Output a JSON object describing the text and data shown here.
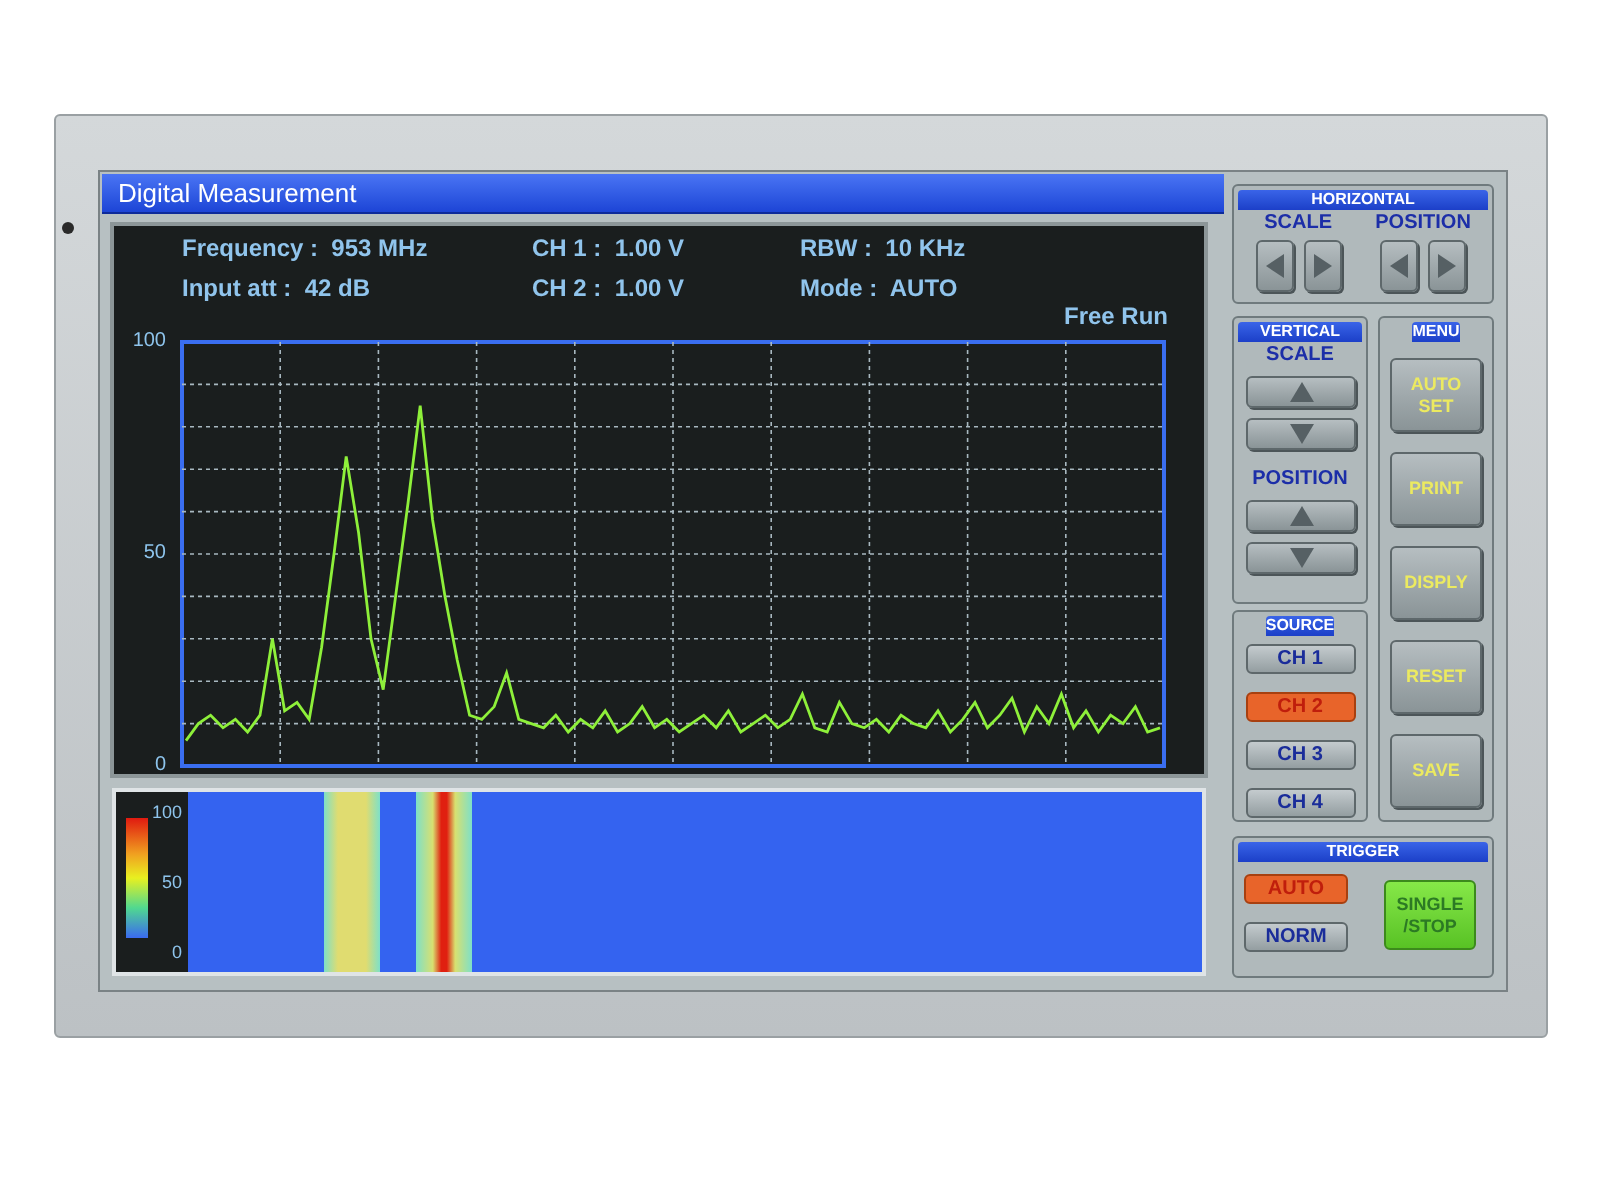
{
  "window": {
    "title": "Digital Measurement"
  },
  "readouts": [
    "Frequency :  953 MHz",
    "CH 1 :  1.00 V",
    "RBW :  10 KHz",
    "Input att :  42 dB",
    "CH 2 :  1.00 V",
    "Mode :  AUTO"
  ],
  "spectrum": {
    "status": "Free Run",
    "chart_data": {
      "type": "line",
      "ylim": [
        0,
        100
      ],
      "yticks": [
        0,
        50,
        100
      ],
      "series": [
        {
          "color": "#8ef03a",
          "values": [
            6,
            10,
            12,
            9,
            11,
            8,
            12,
            30,
            13,
            15,
            11,
            28,
            50,
            73,
            55,
            30,
            18,
            40,
            62,
            85,
            58,
            40,
            25,
            12,
            11,
            14,
            22,
            11,
            10,
            9,
            12,
            8,
            11,
            9,
            13,
            8,
            10,
            14,
            9,
            11,
            8,
            10,
            12,
            9,
            13,
            8,
            10,
            12,
            9,
            11,
            17,
            9,
            8,
            15,
            10,
            9,
            11,
            8,
            12,
            10,
            9,
            13,
            8,
            11,
            15,
            9,
            12,
            16,
            8,
            14,
            10,
            17,
            9,
            13,
            8,
            12,
            10,
            14,
            8,
            9
          ]
        }
      ]
    }
  },
  "waterfall": {
    "scale_labels": [
      "100",
      "50",
      "0"
    ]
  },
  "horizontal": {
    "title": "HORIZONTAL",
    "groups": [
      "SCALE",
      "POSITION"
    ]
  },
  "vertical": {
    "title": "VERTICAL",
    "groups": [
      "SCALE",
      "POSITION"
    ]
  },
  "source": {
    "title": "SOURCE",
    "channels": [
      {
        "label": "CH 1",
        "selected": false
      },
      {
        "label": "CH 2",
        "selected": true
      },
      {
        "label": "CH 3",
        "selected": false
      },
      {
        "label": "CH 4",
        "selected": false
      }
    ]
  },
  "menu": {
    "title": "MENU",
    "buttons": [
      "AUTO SET",
      "PRINT",
      "DISPLY",
      "RESET",
      "SAVE"
    ]
  },
  "trigger": {
    "title": "TRIGGER",
    "modes": [
      {
        "label": "AUTO",
        "selected": true
      },
      {
        "label": "NORM",
        "selected": false
      }
    ],
    "action": "SINGLE /STOP"
  }
}
